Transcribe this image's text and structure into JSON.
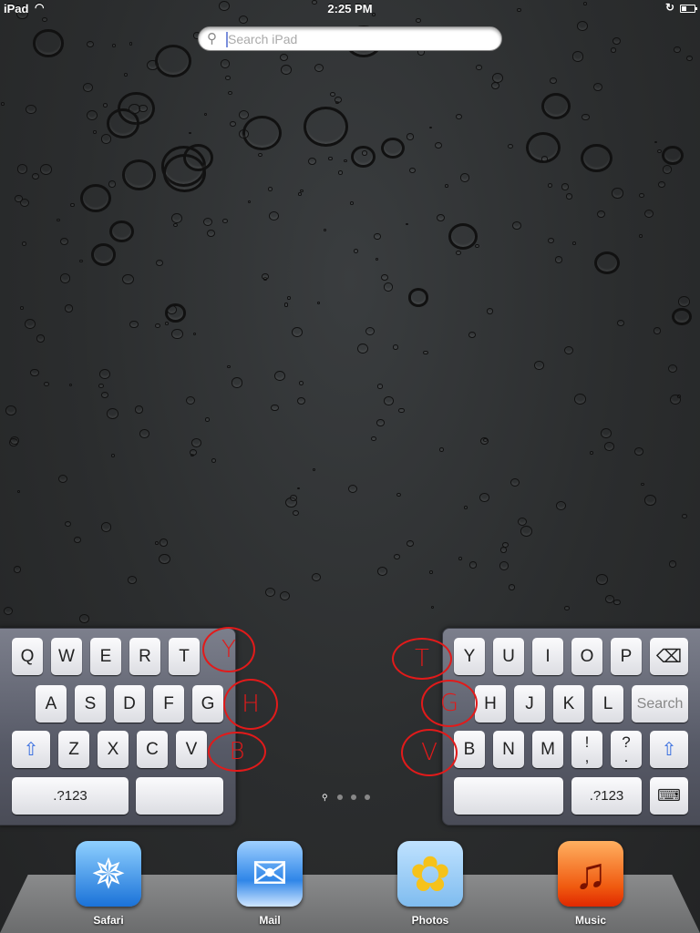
{
  "status_bar": {
    "carrier": "iPad",
    "time": "2:25 PM",
    "wifi_icon": "wifi-icon",
    "lock_icon": "rotation-lock-icon",
    "battery_icon": "battery-icon"
  },
  "search": {
    "placeholder": "Search iPad",
    "value": ""
  },
  "keyboard_left": {
    "rows": [
      [
        "Q",
        "W",
        "E",
        "R",
        "T"
      ],
      [
        "A",
        "S",
        "D",
        "F",
        "G"
      ],
      [
        "shift",
        "Z",
        "X",
        "C",
        "V"
      ],
      [
        ".?123",
        "space"
      ]
    ]
  },
  "keyboard_right": {
    "rows": [
      [
        "Y",
        "U",
        "I",
        "O",
        "P",
        "backspace"
      ],
      [
        "H",
        "J",
        "K",
        "L",
        "Search"
      ],
      [
        "B",
        "N",
        "M",
        "!\n,",
        "?\n.",
        "shift"
      ],
      [
        "space",
        ".?123",
        "hide-keyboard"
      ]
    ]
  },
  "annotations": [
    "Y",
    "H",
    "B",
    "T",
    "G",
    "V"
  ],
  "annotation_color": "#e21a1a",
  "page_indicator": {
    "pages": 3,
    "current": "spotlight"
  },
  "dock": {
    "apps": [
      {
        "label": "Safari"
      },
      {
        "label": "Mail"
      },
      {
        "label": "Photos"
      },
      {
        "label": "Music"
      }
    ]
  }
}
